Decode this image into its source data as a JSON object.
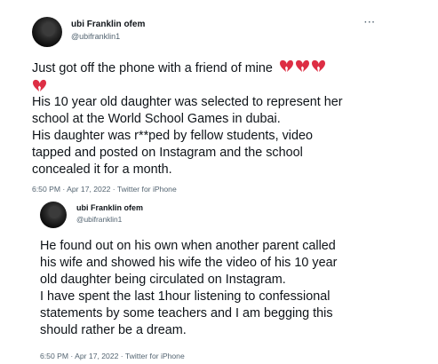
{
  "tweet1": {
    "author_name": "ubi Franklin ofem",
    "author_handle": "@ubifranklin1",
    "more_label": "···",
    "lines": [
      "Just got off the phone with a friend of mine",
      "",
      "His 10 year old daughter was selected to represent her",
      "school  at the World School Games in dubai.",
      "His daughter was r**ped by fellow students, video",
      "tapped and posted on Instagram and the school",
      "concealed it for a month."
    ],
    "emoji_name": "broken-heart-icon",
    "emoji_color": "#dd2e44",
    "timestamp": "6:50 PM · Apr 17, 2022 · Twitter for iPhone"
  },
  "tweet2": {
    "author_name": "ubi Franklin ofem",
    "author_handle": "@ubifranklin1",
    "lines": [
      "He found out on his own when another parent called",
      "his wife and showed his wife the video of his 10 year",
      "old daughter being circulated on Instagram.",
      "I have spent the last 1hour listening to confessional",
      "statements by some teachers and I am begging this",
      "should rather be a dream."
    ],
    "timestamp": "6:50 PM · Apr 17, 2022 · Twitter for iPhone"
  }
}
